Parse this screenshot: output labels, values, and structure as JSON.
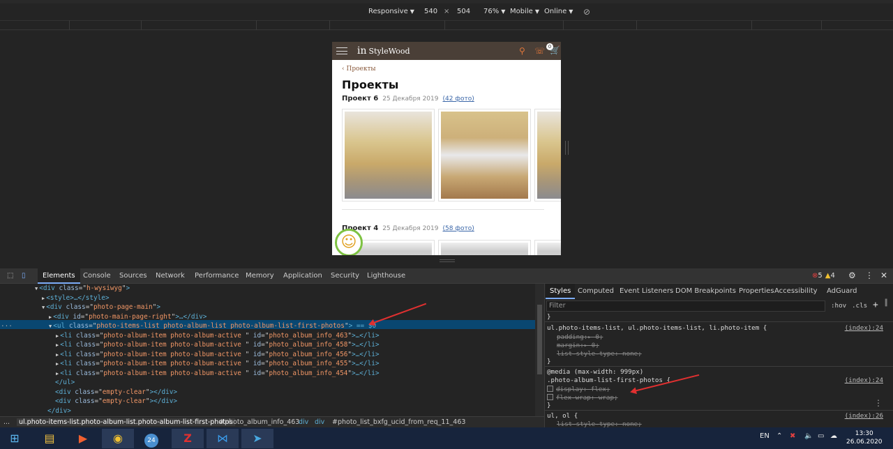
{
  "device_toolbar": {
    "mode": "Responsive",
    "width": "540",
    "times": "×",
    "height": "504",
    "zoom": "76%",
    "device": "Mobile",
    "network": "Online"
  },
  "site": {
    "logo_mark": "in",
    "logo_text": "StyleWood",
    "cart_count": "0",
    "breadcrumb": "Проекты",
    "title": "Проекты",
    "projects": [
      {
        "name": "Проект 6",
        "date": "25 Декабря 2019",
        "photos": "(42 фото)"
      },
      {
        "name": "Проект 4",
        "date": "25 Декабря 2019",
        "photos": "(58 фото)"
      }
    ]
  },
  "devtools": {
    "tabs": [
      "Elements",
      "Console",
      "Sources",
      "Network",
      "Performance",
      "Memory",
      "Application",
      "Security",
      "Lighthouse"
    ],
    "errors": "5",
    "warnings": "4",
    "dom_lines": [
      {
        "indent": 0,
        "arrow": "▼",
        "tag": "div",
        "attrs": [
          [
            "class",
            "h-wysiwyg"
          ]
        ],
        "tail": ">"
      },
      {
        "indent": 1,
        "arrow": "▶",
        "tag": "style",
        "attrs": [],
        "tail": ">…</style>"
      },
      {
        "indent": 1,
        "arrow": "▼",
        "tag": "div",
        "attrs": [
          [
            "class",
            "photo-page-main"
          ]
        ],
        "tail": ">"
      },
      {
        "indent": 2,
        "arrow": "▶",
        "tag": "div",
        "attrs": [
          [
            "id",
            "photo-main-page-right"
          ]
        ],
        "tail": ">…</div>"
      },
      {
        "indent": 2,
        "arrow": "▼",
        "tag": "ul",
        "attrs": [
          [
            "class",
            "photo-items-list photo-album-list photo-album-list-first-photos"
          ]
        ],
        "tail": "> == $0"
      },
      {
        "indent": 3,
        "arrow": "▶",
        "tag": "li",
        "attrs": [
          [
            "class",
            "photo-album-item photo-album-active "
          ],
          [
            "id",
            "photo_album_info_463"
          ]
        ],
        "tail": ">…</li>"
      },
      {
        "indent": 3,
        "arrow": "▶",
        "tag": "li",
        "attrs": [
          [
            "class",
            "photo-album-item photo-album-active "
          ],
          [
            "id",
            "photo_album_info_458"
          ]
        ],
        "tail": ">…</li>"
      },
      {
        "indent": 3,
        "arrow": "▶",
        "tag": "li",
        "attrs": [
          [
            "class",
            "photo-album-item photo-album-active "
          ],
          [
            "id",
            "photo_album_info_456"
          ]
        ],
        "tail": ">…</li>"
      },
      {
        "indent": 3,
        "arrow": "▶",
        "tag": "li",
        "attrs": [
          [
            "class",
            "photo-album-item photo-album-active "
          ],
          [
            "id",
            "photo_album_info_455"
          ]
        ],
        "tail": ">…</li>"
      },
      {
        "indent": 3,
        "arrow": "▶",
        "tag": "li",
        "attrs": [
          [
            "class",
            "photo-album-item photo-album-active "
          ],
          [
            "id",
            "photo_album_info_454"
          ]
        ],
        "tail": ">…</li>"
      },
      {
        "indent": 2,
        "arrow": "",
        "tag": "",
        "attrs": [],
        "tail": "</ul>"
      },
      {
        "indent": 2,
        "arrow": "",
        "tag": "div",
        "attrs": [
          [
            "class",
            "empty-clear"
          ]
        ],
        "tail": "></div>"
      },
      {
        "indent": 2,
        "arrow": "",
        "tag": "div",
        "attrs": [
          [
            "class",
            "empty-clear"
          ]
        ],
        "tail": "></div>"
      },
      {
        "indent": 1,
        "arrow": "",
        "tag": "",
        "attrs": [],
        "tail": "</div>"
      }
    ],
    "breadcrumbs": [
      "...",
      "ul.photo-items-list.photo-album-list.photo-album-list-first-photos",
      "#photo_album_info_463",
      "div",
      "div",
      "#photo_list_bxfg_ucid_from_req_11_463"
    ],
    "style_tabs": [
      "Styles",
      "Computed",
      "Event Listeners",
      "DOM Breakpoints",
      "Properties",
      "Accessibility",
      "AdGuard"
    ],
    "filter_placeholder": "Filter",
    "hov": ":hov",
    "cls": ".cls",
    "plus": "+",
    "rules": {
      "brace": "}",
      "r1_selector": "ul.photo-items-list, ul.photo-items-list, li.photo-item {",
      "r1_source": "(index):24",
      "r1_p1": "padding:▸ 0;",
      "r1_p2": "margin:▸ 0;",
      "r1_p3": "list-style-type: none;",
      "media": "@media (max-width: 999px)",
      "r2_selector": ".photo-album-list-first-photos {",
      "r2_source": "(index):24",
      "r2_p1": "display: flex;",
      "r2_p2": "flex-wrap: wrap;",
      "r3_selector": "ul, ol {",
      "r3_source": "(index):26",
      "r3_p1": "list-style-type: none;"
    }
  },
  "taskbar": {
    "lang": "EN",
    "time": "13:30",
    "date": "26.06.2020",
    "zoom_badge": "24"
  }
}
